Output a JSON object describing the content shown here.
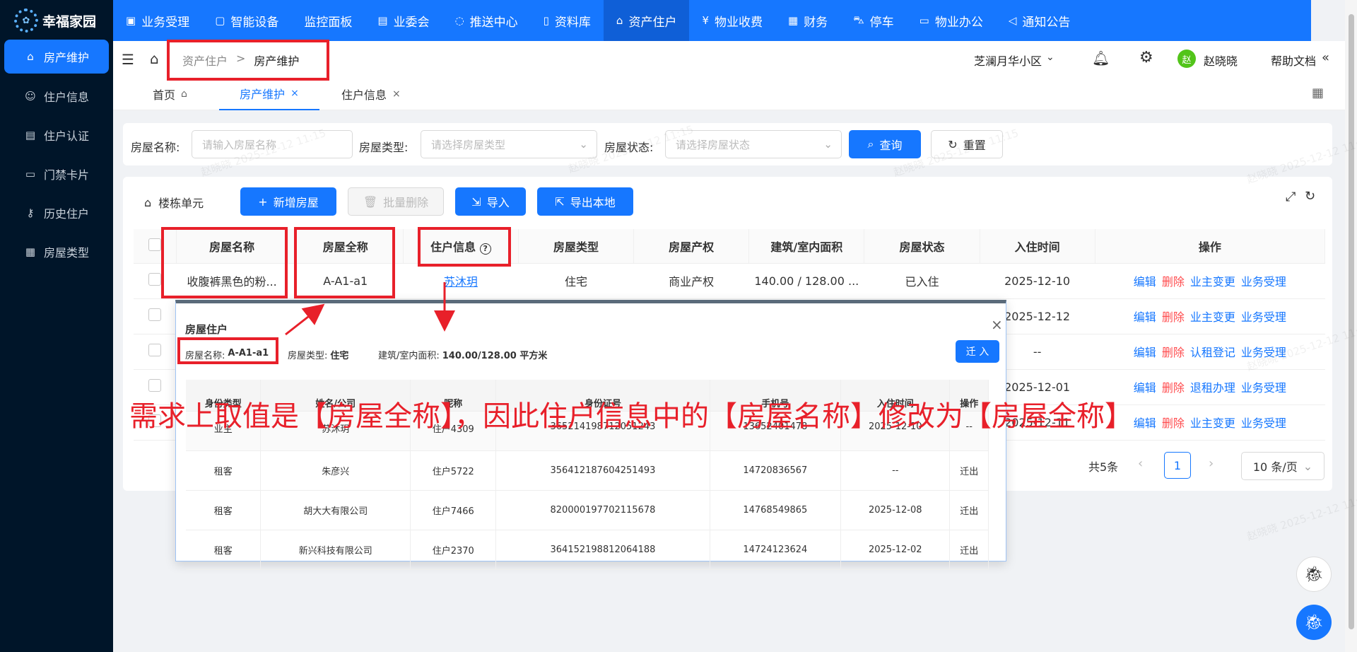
{
  "app": {
    "name": "幸福家园",
    "logo_icon": "gear-logo-icon"
  },
  "sidebar": {
    "items": [
      {
        "label": "房产维护",
        "icon": "home-icon",
        "active": true
      },
      {
        "label": "住户信息",
        "icon": "smile-icon"
      },
      {
        "label": "住户认证",
        "icon": "building-icon"
      },
      {
        "label": "门禁卡片",
        "icon": "card-icon"
      },
      {
        "label": "历史住户",
        "icon": "key-icon"
      },
      {
        "label": "房屋类型",
        "icon": "grid-icon"
      }
    ]
  },
  "topnav": {
    "items": [
      {
        "label": "业务受理",
        "icon": "clipboard-icon"
      },
      {
        "label": "智能设备",
        "icon": "device-icon"
      },
      {
        "label": "监控面板",
        "icon": ""
      },
      {
        "label": "业委会",
        "icon": "document-icon"
      },
      {
        "label": "推送中心",
        "icon": "message-icon"
      },
      {
        "label": "资料库",
        "icon": "book-icon"
      },
      {
        "label": "资产住户",
        "icon": "home-icon",
        "active": true
      },
      {
        "label": "物业收费",
        "icon": "yen-icon"
      },
      {
        "label": "财务",
        "icon": "calendar-icon"
      },
      {
        "label": "停车",
        "icon": "car-icon"
      },
      {
        "label": "物业办公",
        "icon": "monitor-icon"
      },
      {
        "label": "通知公告",
        "icon": "megaphone-icon"
      }
    ]
  },
  "header": {
    "breadcrumb": {
      "parent": "资产住户",
      "separator": ">",
      "current": "房产维护"
    },
    "community": "芝澜月华小区",
    "user_avatar": "赵",
    "user_name": "赵晓晓",
    "help": "帮助文档"
  },
  "tabs": [
    {
      "label": "首页"
    },
    {
      "label": "房产维护",
      "active": true
    },
    {
      "label": "住户信息"
    }
  ],
  "search": {
    "name_label": "房屋名称:",
    "name_placeholder": "请输入房屋名称",
    "type_label": "房屋类型:",
    "type_placeholder": "请选择房屋类型",
    "status_label": "房屋状态:",
    "status_placeholder": "请选择房屋状态",
    "query_label": "查询",
    "reset_label": "重置"
  },
  "toolbar": {
    "building_label": "楼栋单元",
    "add_label": "新增房屋",
    "batch_delete_label": "批量删除",
    "import_label": "导入",
    "export_label": "导出本地"
  },
  "table": {
    "headers": [
      "房屋名称",
      "房屋全称",
      "住户信息",
      "房屋类型",
      "房屋产权",
      "建筑/室内面积",
      "房屋状态",
      "入住时间",
      "操作"
    ],
    "rows": [
      {
        "name": "收腹裤黑色的粉...",
        "full": "A-A1-a1",
        "resident": "苏沐玥",
        "type": "住宅",
        "property": "商业产权",
        "area": "140.00 / 128.00 ...",
        "status": "已入住",
        "date": "2025-12-10",
        "ops": [
          "编辑",
          "删除",
          "业主变更",
          "业务受理"
        ]
      },
      {
        "date": "2025-12-12",
        "ops": [
          "编辑",
          "删除",
          "业主变更",
          "业务受理"
        ]
      },
      {
        "date": "--",
        "ops": [
          "编辑",
          "删除",
          "认租登记",
          "业务受理"
        ]
      },
      {
        "date": "2025-12-01",
        "ops": [
          "编辑",
          "删除",
          "退租办理",
          "业务受理"
        ]
      },
      {
        "date": "2025-12-11",
        "ops": [
          "编辑",
          "删除",
          "业主变更",
          "业务受理"
        ]
      }
    ]
  },
  "pagination": {
    "total": "共5条",
    "page": "1",
    "size": "10 条/页"
  },
  "popup": {
    "title": "房屋住户",
    "name_label": "房屋名称:",
    "name_value": "A-A1-a1",
    "type_label": "房屋类型:",
    "type_value": "住宅",
    "area_label": "建筑/室内面积:",
    "area_value": "140.00/128.00 平方米",
    "movein_label": "迁 入",
    "headers": [
      "身份类型",
      "姓名/公司",
      "昵称",
      "身份证号",
      "手机号",
      "入住时间",
      "操作"
    ],
    "rows": [
      {
        "role": "业主",
        "name": "苏沐玥",
        "nick": "住户4309",
        "id": "365214198712051243",
        "phone": "13652401478",
        "date": "2025-12-10",
        "op": "--"
      },
      {
        "role": "租客",
        "name": "朱彦兴",
        "nick": "住户5722",
        "id": "356412187604251493",
        "phone": "14720836567",
        "date": "--",
        "op": "迁出"
      },
      {
        "role": "租客",
        "name": "胡大大有限公司",
        "nick": "住户7466",
        "id": "820000197702115678",
        "phone": "14768549865",
        "date": "2025-12-08",
        "op": "迁出"
      },
      {
        "role": "租客",
        "name": "新兴科技有限公司",
        "nick": "住户2370",
        "id": "364152198812064188",
        "phone": "14724123624",
        "date": "2025-12-02",
        "op": "迁出"
      }
    ]
  },
  "annotation": "需求上取值是【房屋全称】，因此住户信息中的【房屋名称】修改为【房屋全称】",
  "watermark": "赵晓晓 2025-12-12 11:15",
  "colors": {
    "primary": "#1677ff",
    "sidebar": "#001529",
    "danger": "#ff4d4f",
    "annotation": "#e8202a"
  }
}
